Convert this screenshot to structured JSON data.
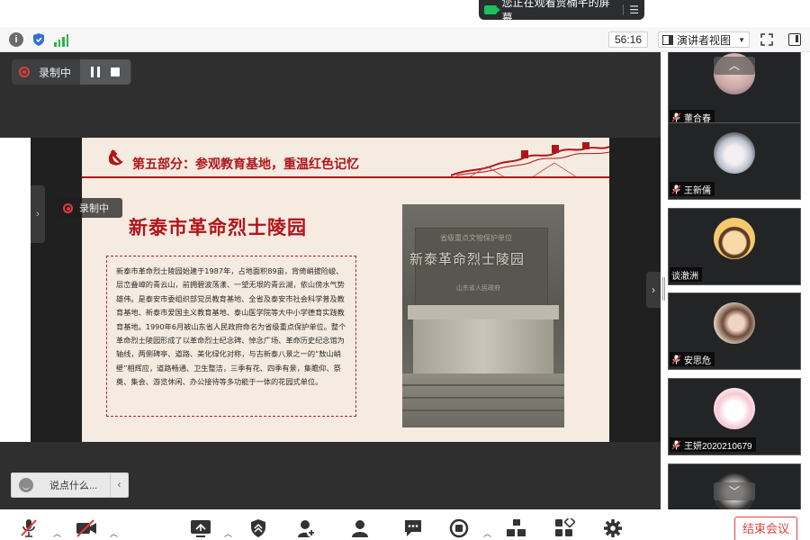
{
  "share_banner": {
    "text": "您正在观看贾楠芊的屏幕"
  },
  "info_bar": {
    "timer": "56:16",
    "view_mode": "演讲者视图"
  },
  "recording": {
    "label": "录制中"
  },
  "slide": {
    "section_title": "第五部分：参观教育基地，重温红色记忆",
    "main_title": "新泰市革命烈士陵园",
    "body": "新泰市革命烈士陵园始建于1987年，占地面积89亩，背倚峭拔险峻、层峦叠嶂的青云山，前拥碧波荡漾、一望无垠的青云湖，依山傍水气势雄伟。是泰安市委组织部党员教育基地、全省及泰安市社会科学普及教育基地、新泰市爱国主义教育基地、泰山医学院等大中小学德育实践教育基地。1990年6月被山东省人民政府命名为省级重点保护单位。整个革命烈士陵园形成了以革命烈士纪念碑、悼念广场、革命历史纪念馆为轴线，两侧碑亭、道路、美化绿化对称，与古新泰八景之一的“敖山峭壁”相辉应，道路畅通、卫生整洁，三季有花、四季有景，集瞻仰、祭奠、集会、游览休闲、办公接待等多功能于一体的花园式单位。",
    "photo_caption_top": "省级重点文物保护单位",
    "photo_caption_main": "新泰革命烈士陵园",
    "photo_caption_sub": "山东省人民政府"
  },
  "chat": {
    "placeholder": "说点什么..."
  },
  "participants": [
    {
      "name": "董合春",
      "muted": true
    },
    {
      "name": "王新儒",
      "muted": true
    },
    {
      "name": "谈澈洲",
      "muted": false
    },
    {
      "name": "安思危",
      "muted": true
    },
    {
      "name": "王妍2020210679",
      "muted": true
    },
    {
      "name": "",
      "muted": false
    }
  ],
  "toolbar": {
    "end_label": "结束会议"
  },
  "colors": {
    "accent_red": "#b0151c",
    "end_red": "#e04040",
    "signal_green": "#2fb24a"
  }
}
